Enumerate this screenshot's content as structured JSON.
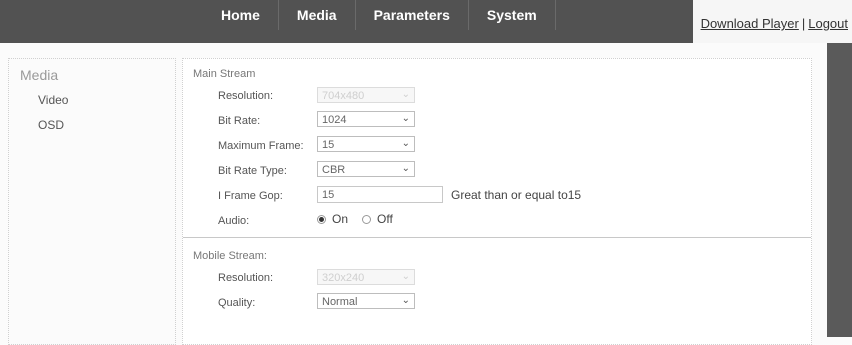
{
  "nav": {
    "items": [
      {
        "label": "Home"
      },
      {
        "label": "Media"
      },
      {
        "label": "Parameters"
      },
      {
        "label": "System"
      }
    ],
    "download_player": "Download Player",
    "separator": "|",
    "logout": "Logout"
  },
  "sidebar": {
    "title": "Media",
    "items": [
      {
        "label": "Video"
      },
      {
        "label": "OSD"
      }
    ]
  },
  "main_stream": {
    "title": "Main Stream",
    "resolution": {
      "label": "Resolution:",
      "value": "704x480",
      "disabled": true
    },
    "bit_rate": {
      "label": "Bit Rate:",
      "value": "1024"
    },
    "max_frame": {
      "label": "Maximum Frame:",
      "value": "15"
    },
    "bit_rate_type": {
      "label": "Bit Rate Type:",
      "value": "CBR"
    },
    "i_frame_gop": {
      "label": "I Frame Gop:",
      "value": "15",
      "hint": "Great than or equal to15"
    },
    "audio": {
      "label": "Audio:",
      "on": "On",
      "off": "Off",
      "selected": "On"
    }
  },
  "mobile_stream": {
    "title": "Mobile Stream:",
    "resolution": {
      "label": "Resolution:",
      "value": "320x240",
      "disabled": true
    },
    "quality": {
      "label": "Quality:",
      "value": "Normal"
    }
  },
  "icons": {
    "dropdown": "chevron-down-icon",
    "chev_glyph": "⌄"
  }
}
